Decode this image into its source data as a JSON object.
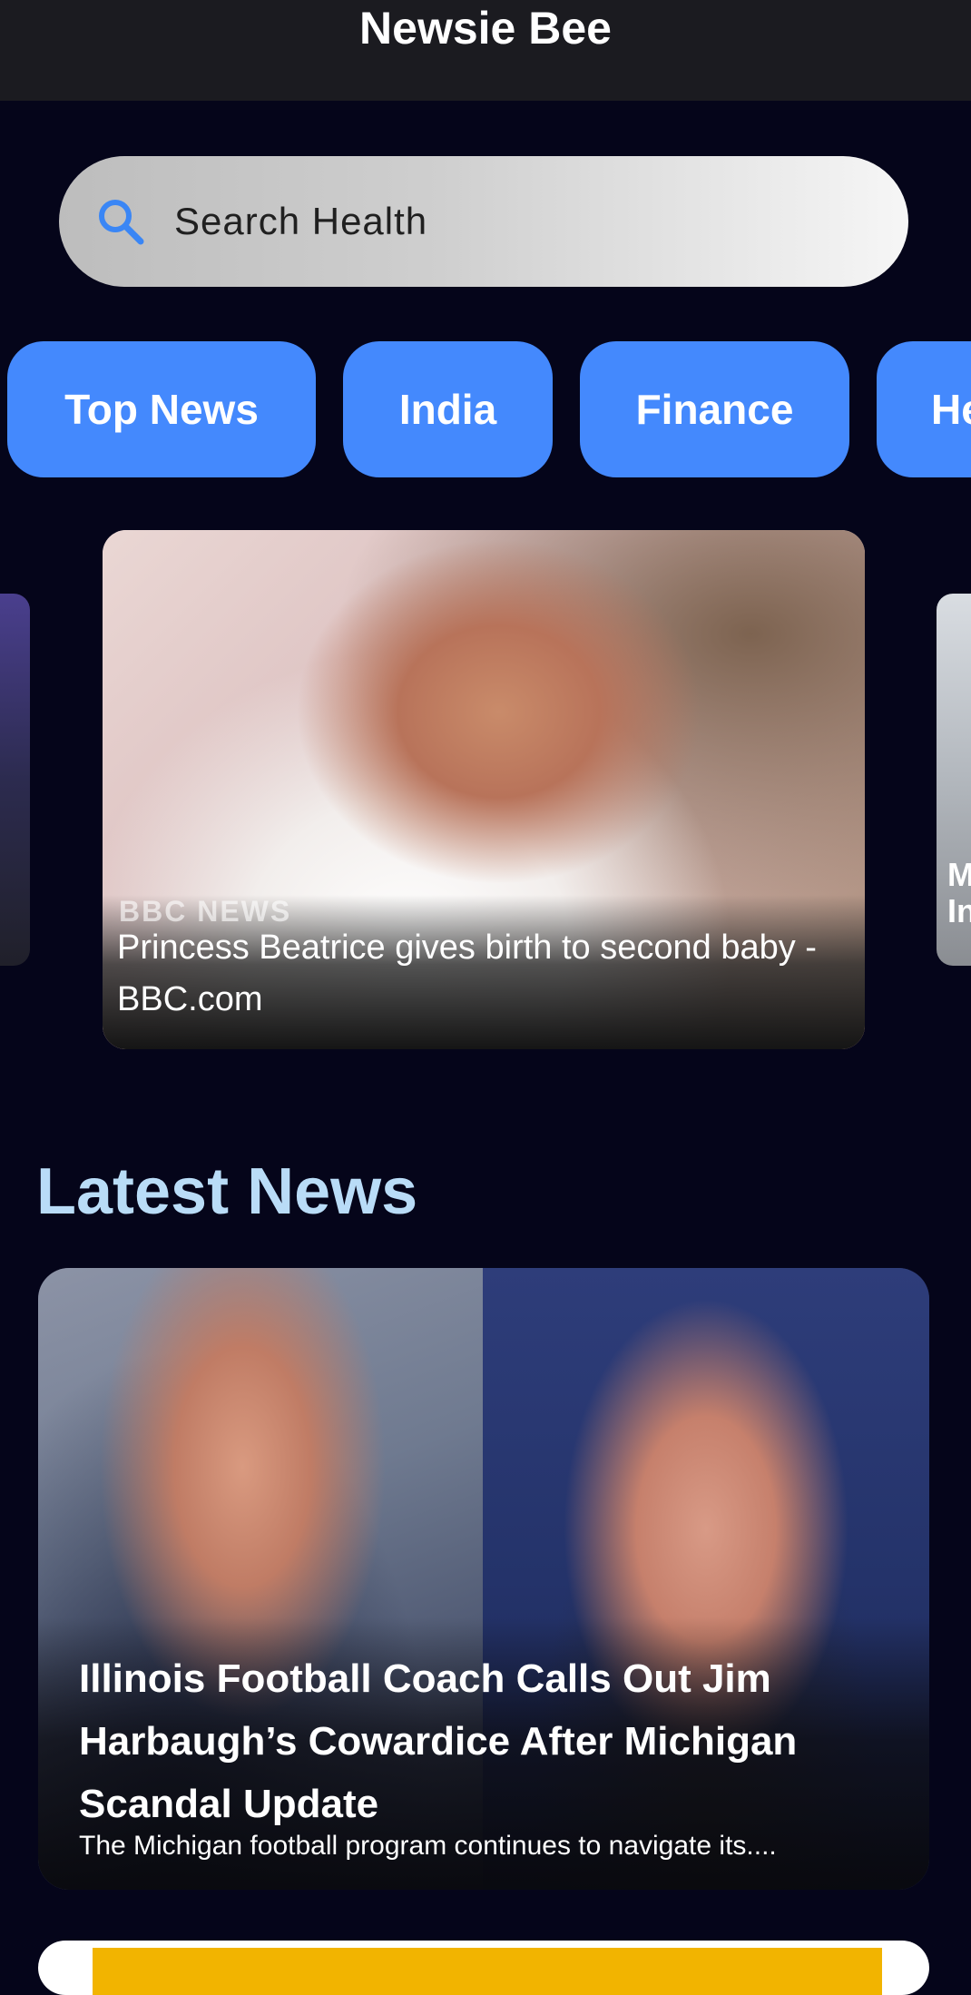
{
  "appbar": {
    "title": "Newsie Bee"
  },
  "search": {
    "placeholder": "Search Health",
    "icon": "search-icon"
  },
  "categories": [
    {
      "label": "Top News"
    },
    {
      "label": "India"
    },
    {
      "label": "Finance"
    },
    {
      "label": "He"
    }
  ],
  "carousel": {
    "main": {
      "watermark": "BBC NEWS",
      "headline": "Princess Beatrice gives birth to second baby - BBC.com"
    },
    "right_peek": "M\nIn"
  },
  "latest": {
    "title": "Latest News",
    "articles": [
      {
        "headline": "Illinois Football Coach Calls Out Jim Harbaugh’s Cowardice After Michigan Scandal Update",
        "description": "The Michigan football program continues to navigate its...."
      }
    ]
  },
  "colors": {
    "background": "#05051a",
    "appbar": "#1b1b20",
    "chip": "#4489fd",
    "section_title": "#b9dcf7"
  }
}
